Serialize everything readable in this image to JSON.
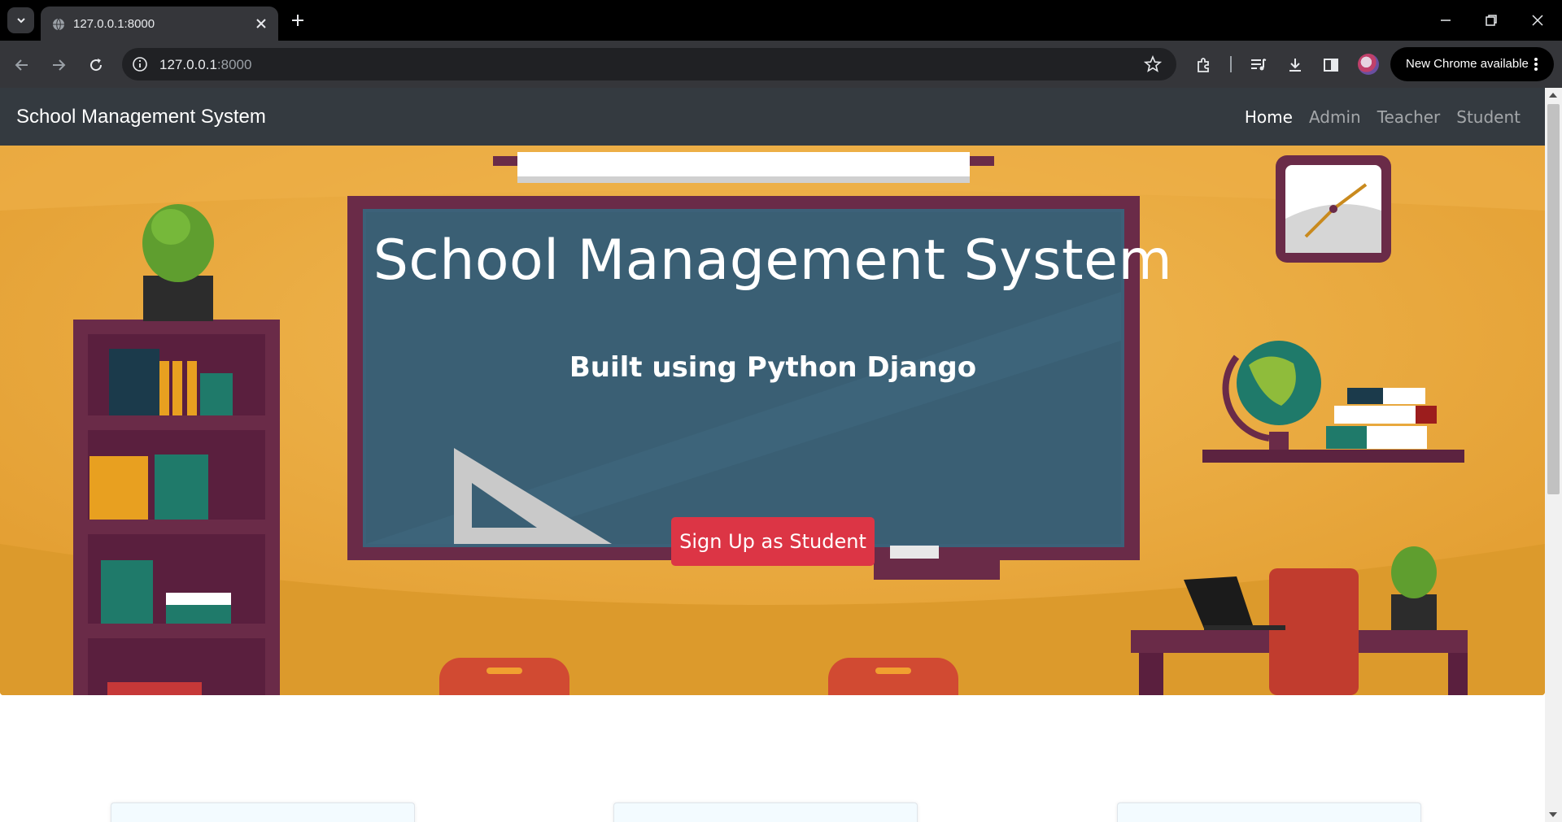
{
  "browser": {
    "tab_title": "127.0.0.1:8000",
    "url_host": "127.0.0.1",
    "url_port": ":8000",
    "update_label": "New Chrome available"
  },
  "site": {
    "brand": "School Management System",
    "nav": [
      {
        "label": "Home",
        "active": true
      },
      {
        "label": "Admin",
        "active": false
      },
      {
        "label": "Teacher",
        "active": false
      },
      {
        "label": "Student",
        "active": false
      }
    ]
  },
  "hero": {
    "title": "School Management System",
    "subtitle": "Built using Python Django",
    "cta_label": "Sign Up as Student"
  },
  "colors": {
    "navbar_bg": "#343a40",
    "cta_bg": "#dc3545",
    "wall": "#e8a83a",
    "chalkboard": "#3a5f74",
    "board_frame": "#6a2b48"
  },
  "icons": [
    "tab-search-icon",
    "globe-favicon-icon",
    "close-icon",
    "plus-icon",
    "minimize-icon",
    "restore-icon",
    "back-icon",
    "forward-icon",
    "reload-icon",
    "info-icon",
    "star-icon",
    "extensions-icon",
    "media-icon",
    "download-icon",
    "side-panel-icon",
    "more-vert-icon"
  ]
}
